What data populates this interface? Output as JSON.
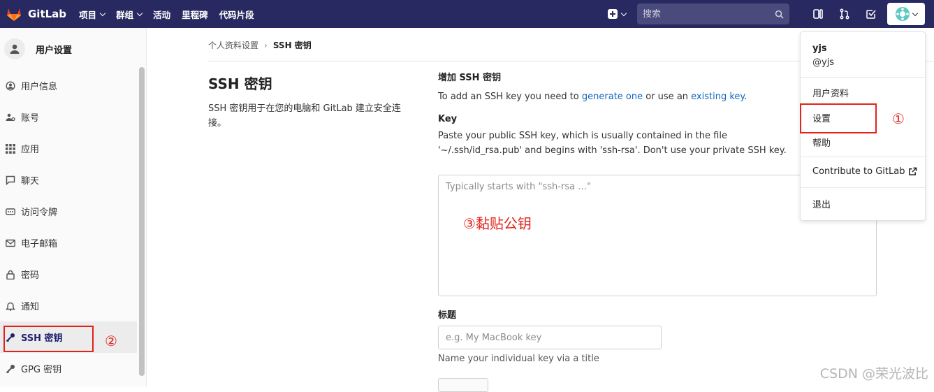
{
  "app": {
    "name": "GitLab"
  },
  "navbar": {
    "menu": [
      {
        "label": "项目",
        "has_dropdown": true
      },
      {
        "label": "群组",
        "has_dropdown": true
      },
      {
        "label": "活动",
        "has_dropdown": false
      },
      {
        "label": "里程碑",
        "has_dropdown": false
      },
      {
        "label": "代码片段",
        "has_dropdown": false
      }
    ],
    "search": {
      "placeholder": "搜索"
    },
    "icons": [
      "new-item-icon",
      "search-icon",
      "issues-icon",
      "merge-requests-icon",
      "todos-icon",
      "avatar-icon"
    ]
  },
  "sidebar": {
    "title": "用户设置",
    "items": [
      {
        "label": "用户信息",
        "icon": "user-icon",
        "active": false
      },
      {
        "label": "账号",
        "icon": "account-icon",
        "active": false
      },
      {
        "label": "应用",
        "icon": "applications-icon",
        "active": false
      },
      {
        "label": "聊天",
        "icon": "chat-icon",
        "active": false
      },
      {
        "label": "访问令牌",
        "icon": "token-icon",
        "active": false
      },
      {
        "label": "电子邮箱",
        "icon": "mail-icon",
        "active": false
      },
      {
        "label": "密码",
        "icon": "lock-icon",
        "active": false
      },
      {
        "label": "通知",
        "icon": "bell-icon",
        "active": false
      },
      {
        "label": "SSH 密钥",
        "icon": "key-icon",
        "active": true
      },
      {
        "label": "GPG 密钥",
        "icon": "key-icon",
        "active": false
      }
    ]
  },
  "breadcrumb": {
    "parent": "个人资料设置",
    "current": "SSH 密钥"
  },
  "page": {
    "title": "SSH 密钥",
    "description": "SSH 密钥用于在您的电脑和 GitLab 建立安全连接。"
  },
  "form": {
    "add_heading": "增加 SSH 密钥",
    "intro_prefix": "To add an SSH key you need to ",
    "intro_link1": "generate one",
    "intro_middle": " or use an ",
    "intro_link2": "existing key",
    "intro_suffix": ".",
    "key_label": "Key",
    "key_help": "Paste your public SSH key, which is usually contained in the file '~/.ssh/id_rsa.pub' and begins with 'ssh-rsa'. Don't use your private SSH key.",
    "key_placeholder": "Typically starts with \"ssh-rsa …\"",
    "title_label": "标题",
    "title_placeholder": "e.g. My MacBook key",
    "title_help": "Name your individual key via a title"
  },
  "user_dropdown": {
    "name": "yjs",
    "handle": "@yjs",
    "items": [
      "用户资料",
      "设置",
      "帮助",
      "Contribute to GitLab",
      "退出"
    ]
  },
  "annotations": {
    "step1": "①",
    "step2": "②",
    "step3": "③黏贴公钥"
  },
  "watermark": "CSDN @荣光波比",
  "colors": {
    "navbar": "#292961",
    "link": "#1068bf",
    "annotation": "#e2231a"
  }
}
